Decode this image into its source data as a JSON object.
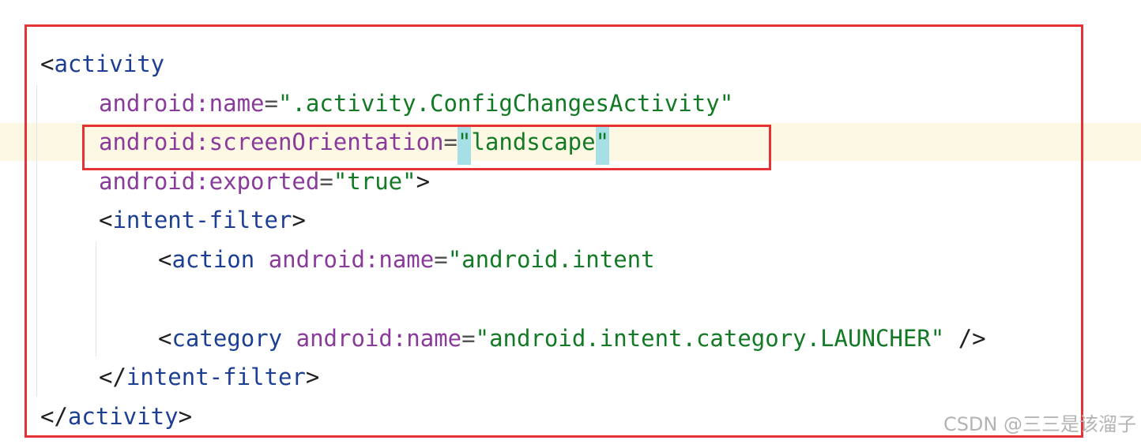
{
  "editor": {
    "lines": [
      {
        "parts": [
          "<",
          "activity"
        ]
      },
      {
        "attr": "android:name",
        "eq": "=",
        "value": "\".activity.ConfigChangesActivity\""
      },
      {
        "attr": "android:screenOrientation",
        "eq": "=",
        "quote_open": "\"",
        "value": "landscape",
        "quote_close": "\""
      },
      {
        "attr": "android:exported",
        "eq": "=",
        "value": "\"true\"",
        "close": ">"
      },
      {
        "open": "<",
        "tag": "intent-filter",
        "close": ">"
      },
      {
        "open": "<",
        "tag": "action",
        "attr": "android:name",
        "eq": "=",
        "value": "\"android.intent"
      },
      {
        "open": "<",
        "tag": "category",
        "attr": "android:name",
        "eq": "=",
        "value": "\"android.intent.category.LAUNCHER\"",
        "close": " />"
      },
      {
        "open": "</",
        "tag": "intent-filter",
        "close": ">"
      },
      {
        "open": "</",
        "tag": "activity",
        "close": ">"
      }
    ]
  },
  "watermark": "CSDN @三三是该溜子",
  "colors": {
    "highlight_box": "#e53237",
    "current_line": "#fdf8e3",
    "quote_match": "#a6dfe6",
    "tag": "#1c3f94",
    "attribute": "#8a3a9a",
    "string": "#127a24"
  }
}
